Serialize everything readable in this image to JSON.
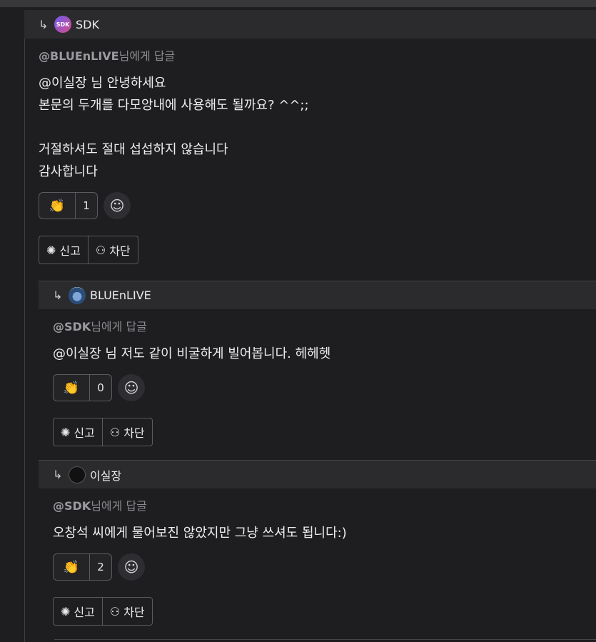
{
  "comments": [
    {
      "author": "SDK",
      "avatar_text": "SDK",
      "reply_to_user": "@BLUEnLIVE",
      "reply_to_suffix": "님에게 답글",
      "content": "@이실장 님 안녕하세요\n본문의 두개를 다모앙내에 사용해도 될까요? ^^;;\n\n거절하셔도 절대 섭섭하지 않습니다\n감사합니다",
      "reaction_icon": "clap-icon",
      "reaction_count": "1",
      "report_label": "신고",
      "block_label": "차단"
    },
    {
      "author": "BLUEnLIVE",
      "reply_to_user": "@SDK",
      "reply_to_suffix": "님에게 답글",
      "content": "@이실장 님 저도 같이 비굴하게 빌어봅니다. 헤헤헷",
      "reaction_icon": "clap-icon",
      "reaction_count": "0",
      "report_label": "신고",
      "block_label": "차단"
    },
    {
      "author": "이실장",
      "reply_to_user": "@SDK",
      "reply_to_suffix": "님에게 답글",
      "content": "오창석 씨에게 물어보진 않았지만 그냥 쓰셔도 됩니다:)",
      "reaction_icon": "clap-icon",
      "reaction_count": "2",
      "report_label": "신고",
      "block_label": "차단"
    }
  ],
  "colors": {
    "background": "#1e1e20",
    "header_bar": "#2b2b2e",
    "muted_text": "#8a8a90"
  }
}
